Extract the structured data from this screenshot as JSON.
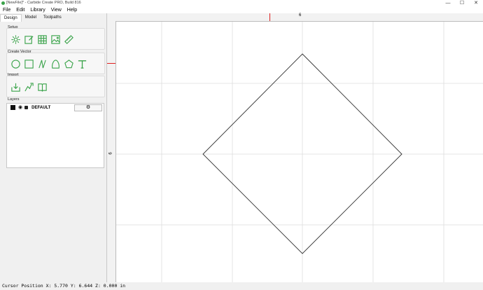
{
  "window": {
    "title": "[NewFile]* - Carbide Create PRO, Build 816",
    "controls": [
      "—",
      "☐",
      "✕"
    ]
  },
  "menu": [
    "File",
    "Edit",
    "Library",
    "View",
    "Help"
  ],
  "tabs": [
    "Design",
    "Model",
    "Toolpaths"
  ],
  "sections": {
    "setup": "Setup",
    "create_vector": "Create Vector",
    "import": "Import",
    "layers": "Layers"
  },
  "layers": [
    {
      "name": "DEFAULT",
      "color": "#111111"
    }
  ],
  "rulers": {
    "horizontal_label": "6",
    "vertical_label": "6"
  },
  "status": {
    "text": "Cursor Position X: 5.770 Y: 6.644 Z: 0.000 in"
  },
  "colors": {
    "icon_green": "#3aa34a",
    "ruler_marker": "#e02020",
    "grid": "#dddddd"
  }
}
